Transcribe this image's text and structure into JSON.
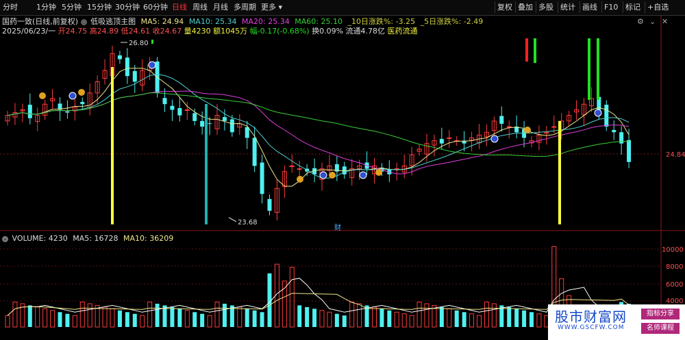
{
  "toolbar": {
    "left": [
      "分时",
      "1分钟",
      "5分钟",
      "15分钟",
      "30分钟",
      "60分钟",
      "日线",
      "周线",
      "月线",
      "多周期",
      "更多"
    ],
    "active_index": 6,
    "right": [
      "复权",
      "叠加",
      "多股",
      "统计",
      "画线",
      "F10",
      "标记",
      "+自选"
    ]
  },
  "header": {
    "stock": "国药一致(日线,前复权)",
    "indicator": "低吸逃顶主图",
    "ma5": "MA5: 24.94",
    "ma10": "MA10: 25.34",
    "ma20": "MA20: 25.34",
    "ma60": "MA60: 25.10",
    "chg10": "_10日涨跌%: -3.25",
    "chg5": "_5日涨跌%: -2.49"
  },
  "quote": {
    "date": "2025/06/23/一",
    "open": "开24.75",
    "high": "高24.89",
    "low": "低24.61",
    "close": "收24.67",
    "volume": "量4230",
    "amount": "额1045万",
    "change": "幅-0.17(-0.68%)",
    "turnover": "换0.09%",
    "float_cap": "流通4.78亿",
    "sector": "医药流通"
  },
  "annotations": {
    "high_label": "26.80",
    "low_label": "23.68",
    "price_label": "24.84",
    "cai": "财"
  },
  "volume_header": {
    "vol": "VOLUME: 4230",
    "ma5": "MA5: 16728",
    "ma10": "MA10: 36209"
  },
  "volume_axis": [
    "10000",
    "8000",
    "6000",
    "4000"
  ],
  "colors": {
    "up": "#ff3c3c",
    "down": "#4ff0f0",
    "ma5": "#f0e68c",
    "ma10": "#4fd0d0",
    "ma20": "#e040e0",
    "ma60": "#38d038",
    "yellow_signal": "#ffff40",
    "green_signal": "#20e020",
    "red_signal": "#ff2020"
  },
  "watermark": {
    "title": "股市财富网",
    "url": "WWW.GSCFW.COM",
    "tag1": "指标分享",
    "tag2": "名师课程"
  }
}
